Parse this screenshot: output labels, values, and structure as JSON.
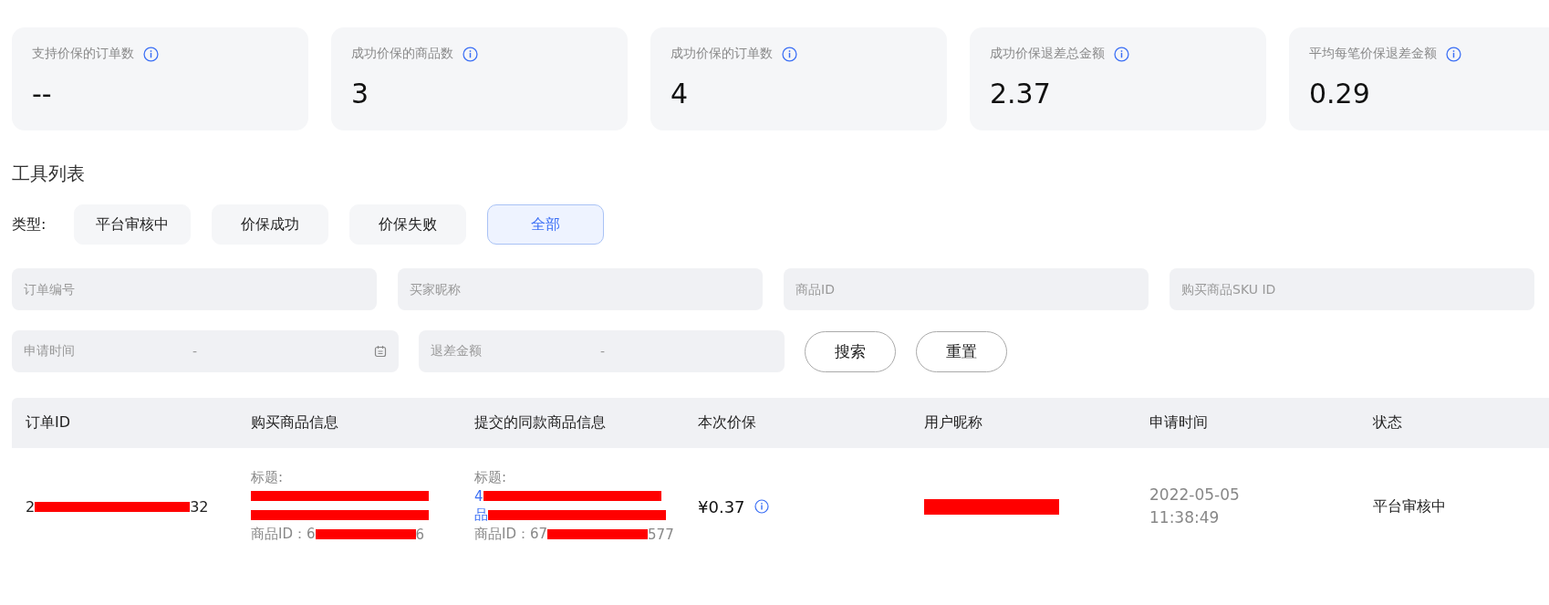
{
  "stats": [
    {
      "label": "支持价保的订单数",
      "value": "--"
    },
    {
      "label": "成功价保的商品数",
      "value": "3"
    },
    {
      "label": "成功价保的订单数",
      "value": "4"
    },
    {
      "label": "成功价保退差总金额",
      "value": "2.37"
    },
    {
      "label": "平均每笔价保退差金额",
      "value": "0.29"
    }
  ],
  "section_title": "工具列表",
  "type_filter": {
    "label": "类型:",
    "options": [
      {
        "label": "平台审核中",
        "selected": false
      },
      {
        "label": "价保成功",
        "selected": false
      },
      {
        "label": "价保失败",
        "selected": false
      },
      {
        "label": "全部",
        "selected": true
      }
    ]
  },
  "search_fields": [
    {
      "placeholder": "订单编号"
    },
    {
      "placeholder": "买家昵称"
    },
    {
      "placeholder": "商品ID"
    },
    {
      "placeholder": "购买商品SKU ID"
    }
  ],
  "date_range": {
    "placeholder": "申请时间",
    "separator": "-"
  },
  "amount_range": {
    "placeholder": "退差金额",
    "separator": "-"
  },
  "buttons": [
    "搜索",
    "重置"
  ],
  "table": {
    "columns": [
      "订单ID",
      "购买商品信息",
      "提交的同款商品信息",
      "本次价保",
      "用户昵称",
      "申请时间",
      "状态"
    ],
    "rows": [
      {
        "order_id": [
          [
            {
              "kind": "text",
              "text": "2"
            },
            {
              "kind": "redacted"
            },
            {
              "kind": "text",
              "text": "32"
            }
          ]
        ],
        "purchased": {
          "title_label": "标题:",
          "title_lines": [
            [
              {
                "kind": "redacted"
              }
            ],
            [
              {
                "kind": "redacted"
              }
            ]
          ],
          "product_id": [
            {
              "kind": "text",
              "text": "商品ID：6"
            },
            {
              "kind": "redacted"
            },
            {
              "kind": "text",
              "text": "6"
            }
          ]
        },
        "submitted": {
          "title_label": "标题:",
          "title_lines": [
            [
              {
                "kind": "text",
                "text": "4"
              },
              {
                "kind": "redacted"
              }
            ],
            [
              {
                "kind": "text",
                "text": "品"
              },
              {
                "kind": "redacted"
              }
            ]
          ],
          "product_id": [
            {
              "kind": "text",
              "text": "商品ID：67"
            },
            {
              "kind": "redacted"
            },
            {
              "kind": "text",
              "text": "577"
            }
          ]
        },
        "price": "¥0.37",
        "nickname": [
          [
            {
              "kind": "redacted"
            }
          ]
        ],
        "apply_date": "2022-05-05",
        "apply_time": "11:38:49",
        "status": "平台审核中"
      }
    ]
  }
}
